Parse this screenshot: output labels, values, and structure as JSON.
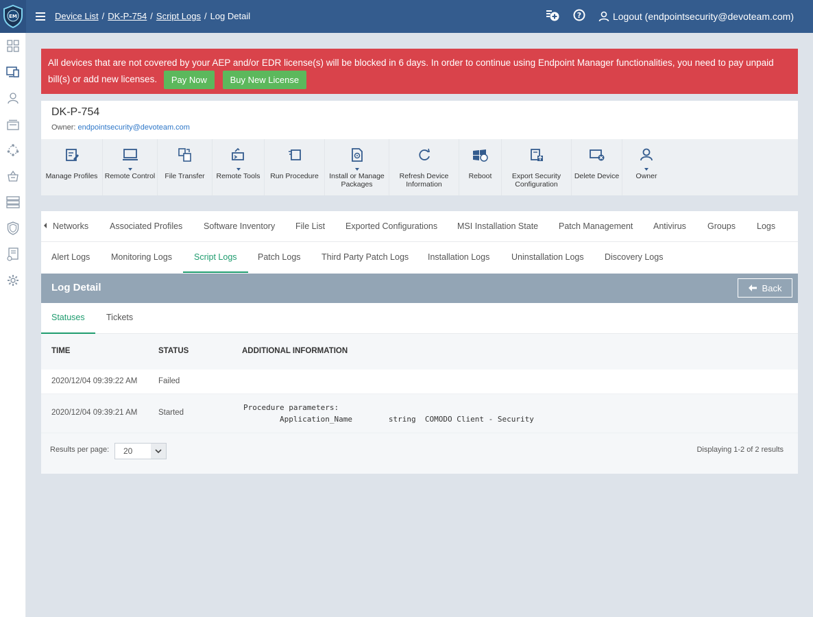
{
  "app": {
    "logo_text": "EM"
  },
  "breadcrumb": {
    "items": [
      "Device List",
      "DK-P-754",
      "Script Logs"
    ],
    "current": "Log Detail",
    "separator": "/"
  },
  "header": {
    "logout_label": "Logout (endpointsecurity@devoteam.com)"
  },
  "sidebar": {
    "icons": [
      "dashboard-icon",
      "devices-icon",
      "users-icon",
      "configuration-icon",
      "network-icon",
      "store-icon",
      "server-icon",
      "security-icon",
      "reports-icon",
      "settings-icon"
    ]
  },
  "alert": {
    "message": "All devices that are not covered by your AEP and/or EDR license(s) will be blocked in 6 days. In order to continue using Endpoint Manager functionalities, you need to pay unpaid bill(s) or add new licenses.",
    "pay_now": "Pay Now",
    "buy_license": "Buy New License",
    "color": "#d9434b"
  },
  "device": {
    "name": "DK-P-754",
    "owner_label": "Owner:",
    "owner_email": "endpointsecurity@devoteam.com"
  },
  "toolbar": [
    {
      "label": "Manage Profiles",
      "icon": "manage-profiles-icon"
    },
    {
      "label": "Remote Control",
      "icon": "remote-control-icon"
    },
    {
      "label": "File Transfer",
      "icon": "file-transfer-icon"
    },
    {
      "label": "Remote Tools",
      "icon": "remote-tools-icon"
    },
    {
      "label": "Run Procedure",
      "icon": "run-procedure-icon"
    },
    {
      "label": "Install or Manage Packages",
      "icon": "packages-icon"
    },
    {
      "label": "Refresh Device Information",
      "icon": "refresh-icon"
    },
    {
      "label": "Reboot",
      "icon": "reboot-icon"
    },
    {
      "label": "Export Security Configuration",
      "icon": "export-icon"
    },
    {
      "label": "Delete Device",
      "icon": "delete-device-icon"
    },
    {
      "label": "Owner",
      "icon": "owner-icon"
    }
  ],
  "tabs_main": [
    "Networks",
    "Associated Profiles",
    "Software Inventory",
    "File List",
    "Exported Configurations",
    "MSI Installation State",
    "Patch Management",
    "Antivirus",
    "Groups",
    "Logs"
  ],
  "tabs_logs": [
    "Alert Logs",
    "Monitoring Logs",
    "Script Logs",
    "Patch Logs",
    "Third Party Patch Logs",
    "Installation Logs",
    "Uninstallation Logs",
    "Discovery Logs"
  ],
  "log_detail": {
    "title": "Log Detail",
    "back_label": "Back"
  },
  "detail_tabs": [
    "Statuses",
    "Tickets"
  ],
  "table": {
    "headers": [
      "TIME",
      "STATUS",
      "ADDITIONAL INFORMATION"
    ],
    "rows": [
      {
        "time": "2020/12/04 09:39:22 AM",
        "status": "Failed",
        "info": ""
      },
      {
        "time": "2020/12/04 09:39:21 AM",
        "status": "Started",
        "info": "Procedure parameters:\n        Application_Name        string  COMODO Client - Security"
      }
    ]
  },
  "pagination": {
    "results_per_page_label": "Results per page:",
    "per_page_value": "20",
    "display_text": "Displaying 1-2 of 2 results"
  },
  "colors": {
    "topbar": "#345c8e",
    "accent_green": "#1f9c6f",
    "button_green": "#5cb85c"
  }
}
